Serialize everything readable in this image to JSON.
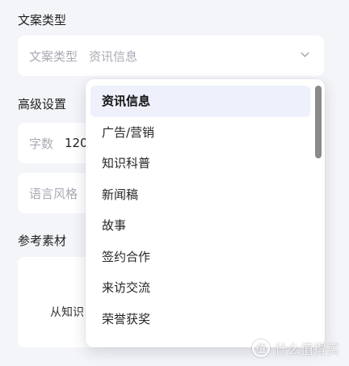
{
  "sections": {
    "content_type": "文案类型",
    "advanced": "高级设置",
    "reference": "参考素材"
  },
  "content_type_field": {
    "prefix": "文案类型",
    "value": "资讯信息"
  },
  "word_count_field": {
    "prefix": "字数",
    "value": "120"
  },
  "style_field": {
    "prefix": "语言风格"
  },
  "reference_box": {
    "hint": "从知识"
  },
  "dropdown": {
    "items": [
      {
        "label": "资讯信息",
        "selected": true
      },
      {
        "label": "广告/营销"
      },
      {
        "label": "知识科普"
      },
      {
        "label": "新闻稿"
      },
      {
        "label": "故事"
      },
      {
        "label": "签约合作"
      },
      {
        "label": "来访交流"
      },
      {
        "label": "荣誉获奖"
      }
    ]
  },
  "watermark": {
    "logo": "值",
    "text": "什么值得买"
  },
  "colors": {
    "background": "#f4f5f9",
    "selected_item_bg": "#eef0fb",
    "placeholder": "#a9abb3"
  }
}
